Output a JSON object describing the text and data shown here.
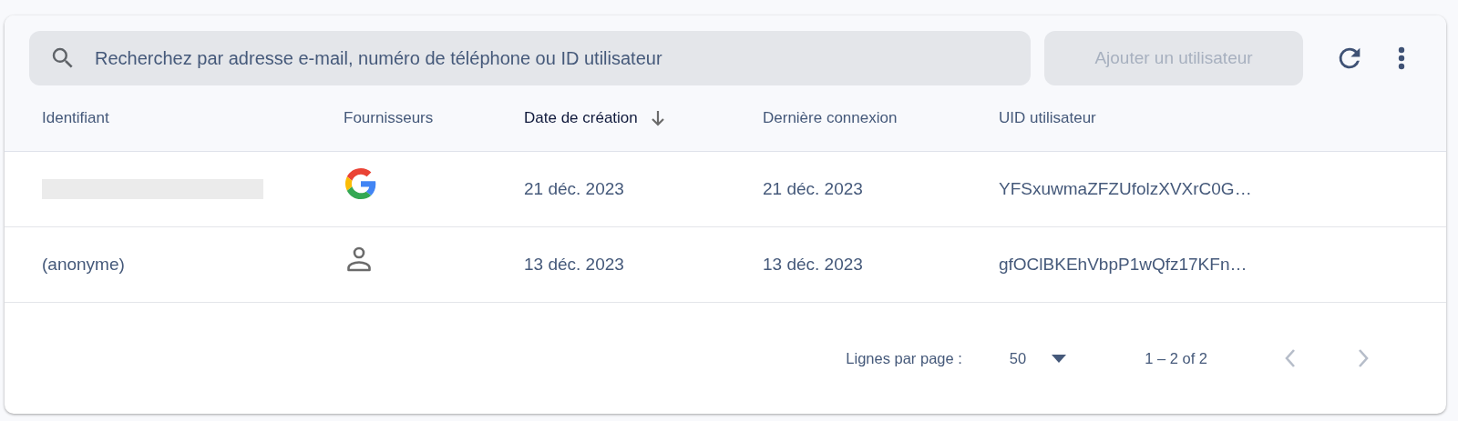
{
  "toolbar": {
    "search": {
      "placeholder": "Recherchez par adresse e-mail, numéro de téléphone ou ID utilisateur"
    },
    "add_button": {
      "label": "Ajouter un utilisateur",
      "disabled": true
    }
  },
  "table": {
    "columns": [
      {
        "label": "Identifiant",
        "sorted": false
      },
      {
        "label": "Fournisseurs",
        "sorted": false
      },
      {
        "label": "Date de création",
        "sorted": true
      },
      {
        "label": "Dernière connexion",
        "sorted": false
      },
      {
        "label": "UID utilisateur",
        "sorted": false
      }
    ],
    "rows": [
      {
        "identifier_redacted": true,
        "provider": {
          "kind": "google"
        },
        "created": "21 déc. 2023",
        "last_sign_in": "21 déc. 2023",
        "uid": "YFSxuwmaZFZUfolzXVXrC0G…"
      },
      {
        "identifier": "(anonyme)",
        "provider": {
          "kind": "anonymous"
        },
        "created": "13 déc. 2023",
        "last_sign_in": "13 déc. 2023",
        "uid": "gfOClBKEhVbpP1wQfz17KFn…"
      }
    ]
  },
  "pagination": {
    "rows_per_page_label": "Lignes par page :",
    "rows_per_page": "50",
    "range": "1 – 2 of 2",
    "prev_disabled": true,
    "next_disabled": true
  }
}
